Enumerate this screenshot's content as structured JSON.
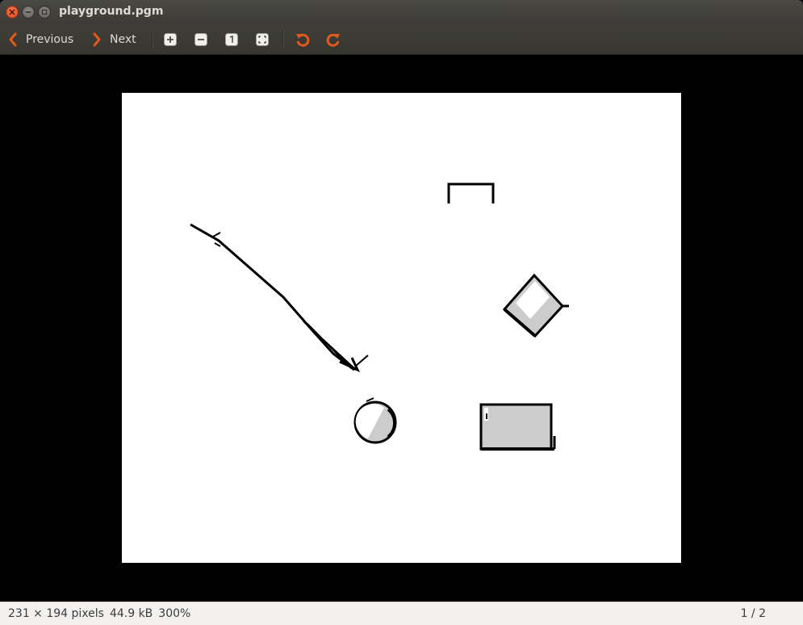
{
  "window": {
    "title": "playground.pgm"
  },
  "toolbar": {
    "previous_label": "Previous",
    "next_label": "Next",
    "icons": [
      "zoom-in-icon",
      "zoom-out-icon",
      "normal-size-icon",
      "best-fit-icon",
      "rotate-left-icon",
      "rotate-right-icon"
    ]
  },
  "status": {
    "dimensions": "231 × 194 pixels",
    "size": "44.9 kB",
    "zoom": "300%",
    "page": "1 / 2"
  },
  "colors": {
    "accent": "#e05a1c",
    "titlebar": "#3b3a36",
    "viewer_bg": "#000000",
    "image_bg": "#ffffff",
    "shape_fill": "#cccccc"
  }
}
